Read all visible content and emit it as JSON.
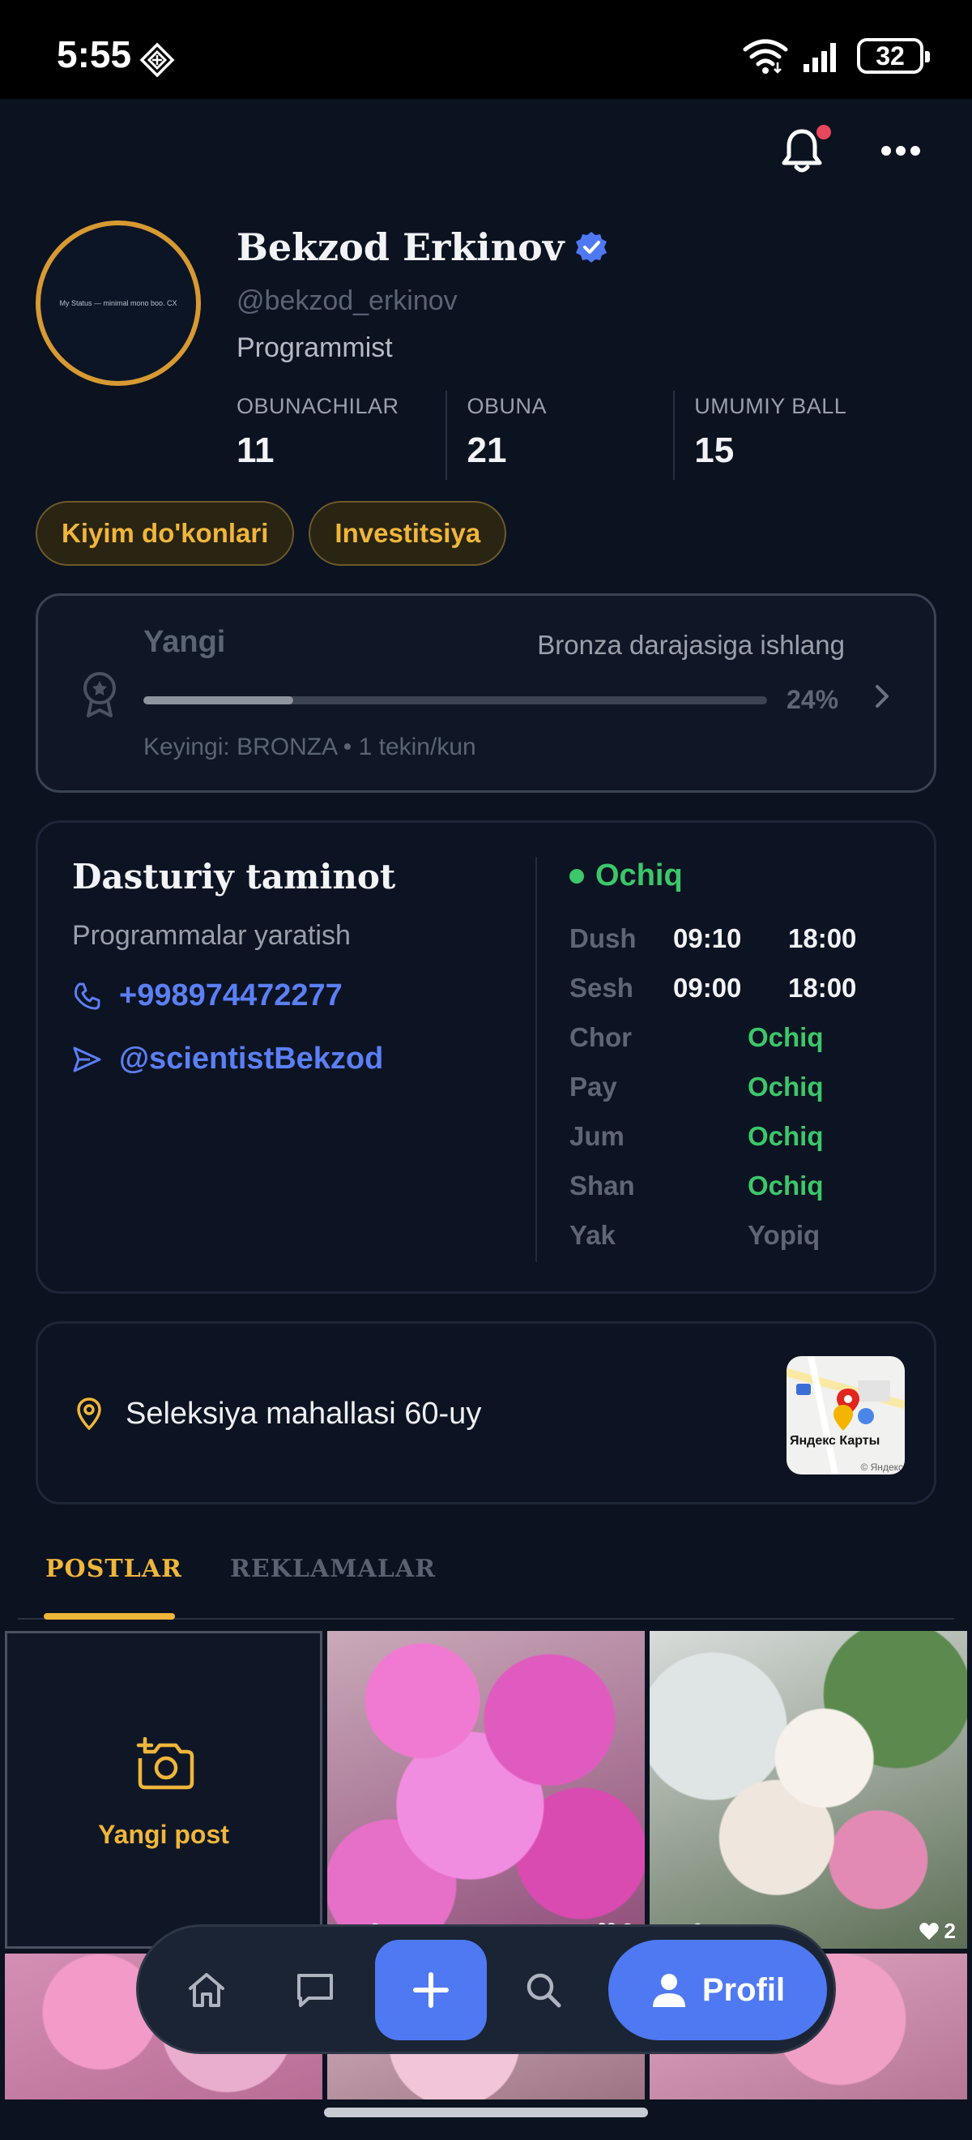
{
  "status_bar": {
    "time": "5:55",
    "battery": "32"
  },
  "profile": {
    "avatar_text": "My Status — minimal mono boo. CX",
    "name": "Bekzod Erkinov",
    "username": "@bekzod_erkinov",
    "bio": "Programmist",
    "stats": [
      {
        "label": "OBUNACHILAR",
        "value": "11"
      },
      {
        "label": "OBUNA",
        "value": "21"
      },
      {
        "label": "UMUMIY BALL",
        "value": "15"
      }
    ],
    "chips": [
      "Kiyim do'konlari",
      "Investitsiya"
    ]
  },
  "level": {
    "title": "Yangi",
    "hint": "Bronza darajasiga ishlang",
    "progress_percent": 24,
    "progress_label": "24%",
    "next": "Keyingi: BRONZA • 1 tekin/kun"
  },
  "business": {
    "title": "Dasturiy taminot",
    "subtitle": "Programmalar yaratish",
    "phone": "+998974472277",
    "telegram": "@scientistBekzod",
    "status": "Ochiq",
    "hours": [
      {
        "day": "Dush",
        "open": "09:10",
        "close": "18:00"
      },
      {
        "day": "Sesh",
        "open": "09:00",
        "close": "18:00"
      },
      {
        "day": "Chor",
        "state": "Ochiq"
      },
      {
        "day": "Pay",
        "state": "Ochiq"
      },
      {
        "day": "Jum",
        "state": "Ochiq"
      },
      {
        "day": "Shan",
        "state": "Ochiq"
      },
      {
        "day": "Yak",
        "state": "Yopiq"
      }
    ]
  },
  "address": {
    "text": "Seleksiya mahallasi 60-uy",
    "map_brand": "Яндекс Карты",
    "map_copyright": "© Яндекс"
  },
  "tabs": [
    "POSTLAR",
    "REKLAMALAR"
  ],
  "posts": {
    "new_post_label": "Yangi post",
    "items": [
      {
        "views": "0",
        "likes": "2"
      },
      {
        "views": "0",
        "likes": "2"
      }
    ]
  },
  "bottom_nav": {
    "profile_label": "Profil"
  },
  "colors": {
    "background": "#0b1220",
    "accent_gold": "#f0b63a",
    "accent_blue": "#4f79f2",
    "open_green": "#3bc76a"
  }
}
